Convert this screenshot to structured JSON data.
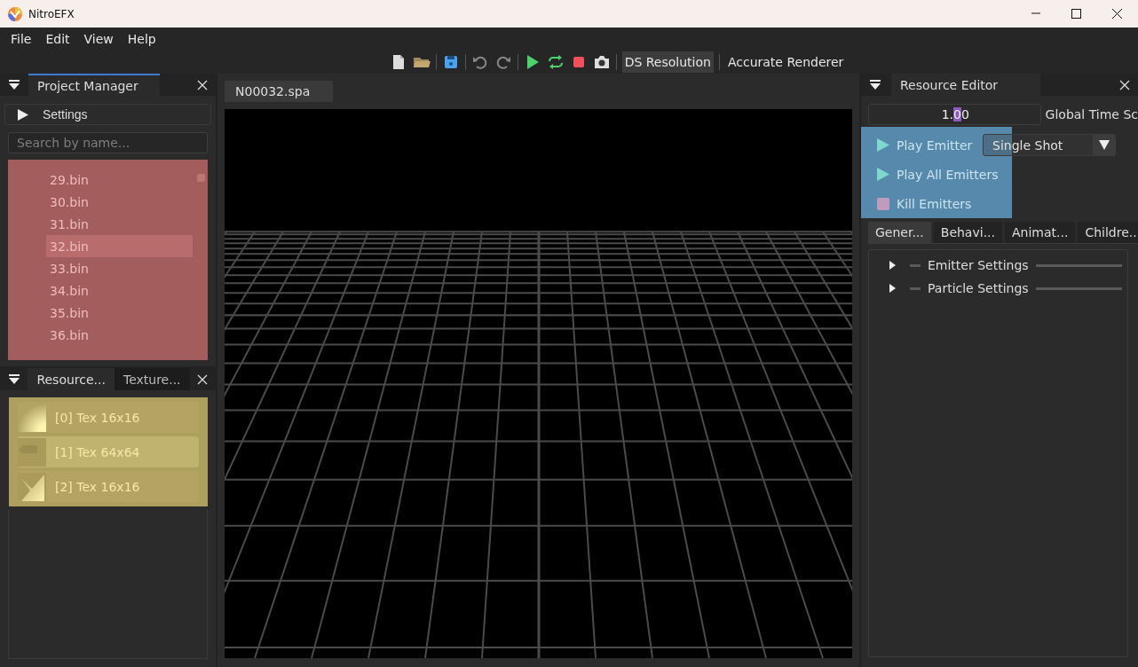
{
  "window": {
    "title": "NitroEFX"
  },
  "menu": [
    "File",
    "Edit",
    "View",
    "Help"
  ],
  "toolbar": {
    "toggles": [
      {
        "label": "DS Resolution",
        "checked": true
      },
      {
        "label": "Accurate Renderer",
        "checked": false
      }
    ]
  },
  "project_manager": {
    "tab": "Project Manager",
    "settings": "Settings",
    "search": {
      "placeholder": "Search by name..."
    },
    "files": [
      {
        "name": "29.bin",
        "selected": false
      },
      {
        "name": "30.bin",
        "selected": false
      },
      {
        "name": "31.bin",
        "selected": false
      },
      {
        "name": "32.bin",
        "selected": true
      },
      {
        "name": "33.bin",
        "selected": false
      },
      {
        "name": "34.bin",
        "selected": false
      },
      {
        "name": "35.bin",
        "selected": false
      },
      {
        "name": "36.bin",
        "selected": false
      }
    ]
  },
  "resource_dock": {
    "tabs": [
      {
        "label": "Resource...",
        "selected": true
      },
      {
        "label": "Texture...",
        "selected": false
      }
    ],
    "textures": [
      {
        "label": "[0] Tex 16x16",
        "selected": false
      },
      {
        "label": "[1] Tex 64x64",
        "selected": true
      },
      {
        "label": "[2] Tex 16x16",
        "selected": false
      }
    ]
  },
  "editor": {
    "tab": "N00032.spa"
  },
  "resource_editor": {
    "tab": "Resource Editor",
    "time_scale": {
      "value": "1.00",
      "label": "Global Time Sc"
    },
    "actions": [
      "Play Emitter",
      "Play All Emitters",
      "Kill Emitters"
    ],
    "mode": "Single Shot",
    "tabs": [
      {
        "label": "Gener...",
        "selected": true
      },
      {
        "label": "Behavi...",
        "selected": false
      },
      {
        "label": "Animat...",
        "selected": false
      },
      {
        "label": "Childre...",
        "selected": false
      }
    ],
    "sections": [
      {
        "label": "Emitter Settings",
        "expanded": false
      },
      {
        "label": "Particle Settings",
        "expanded": false
      }
    ]
  }
}
